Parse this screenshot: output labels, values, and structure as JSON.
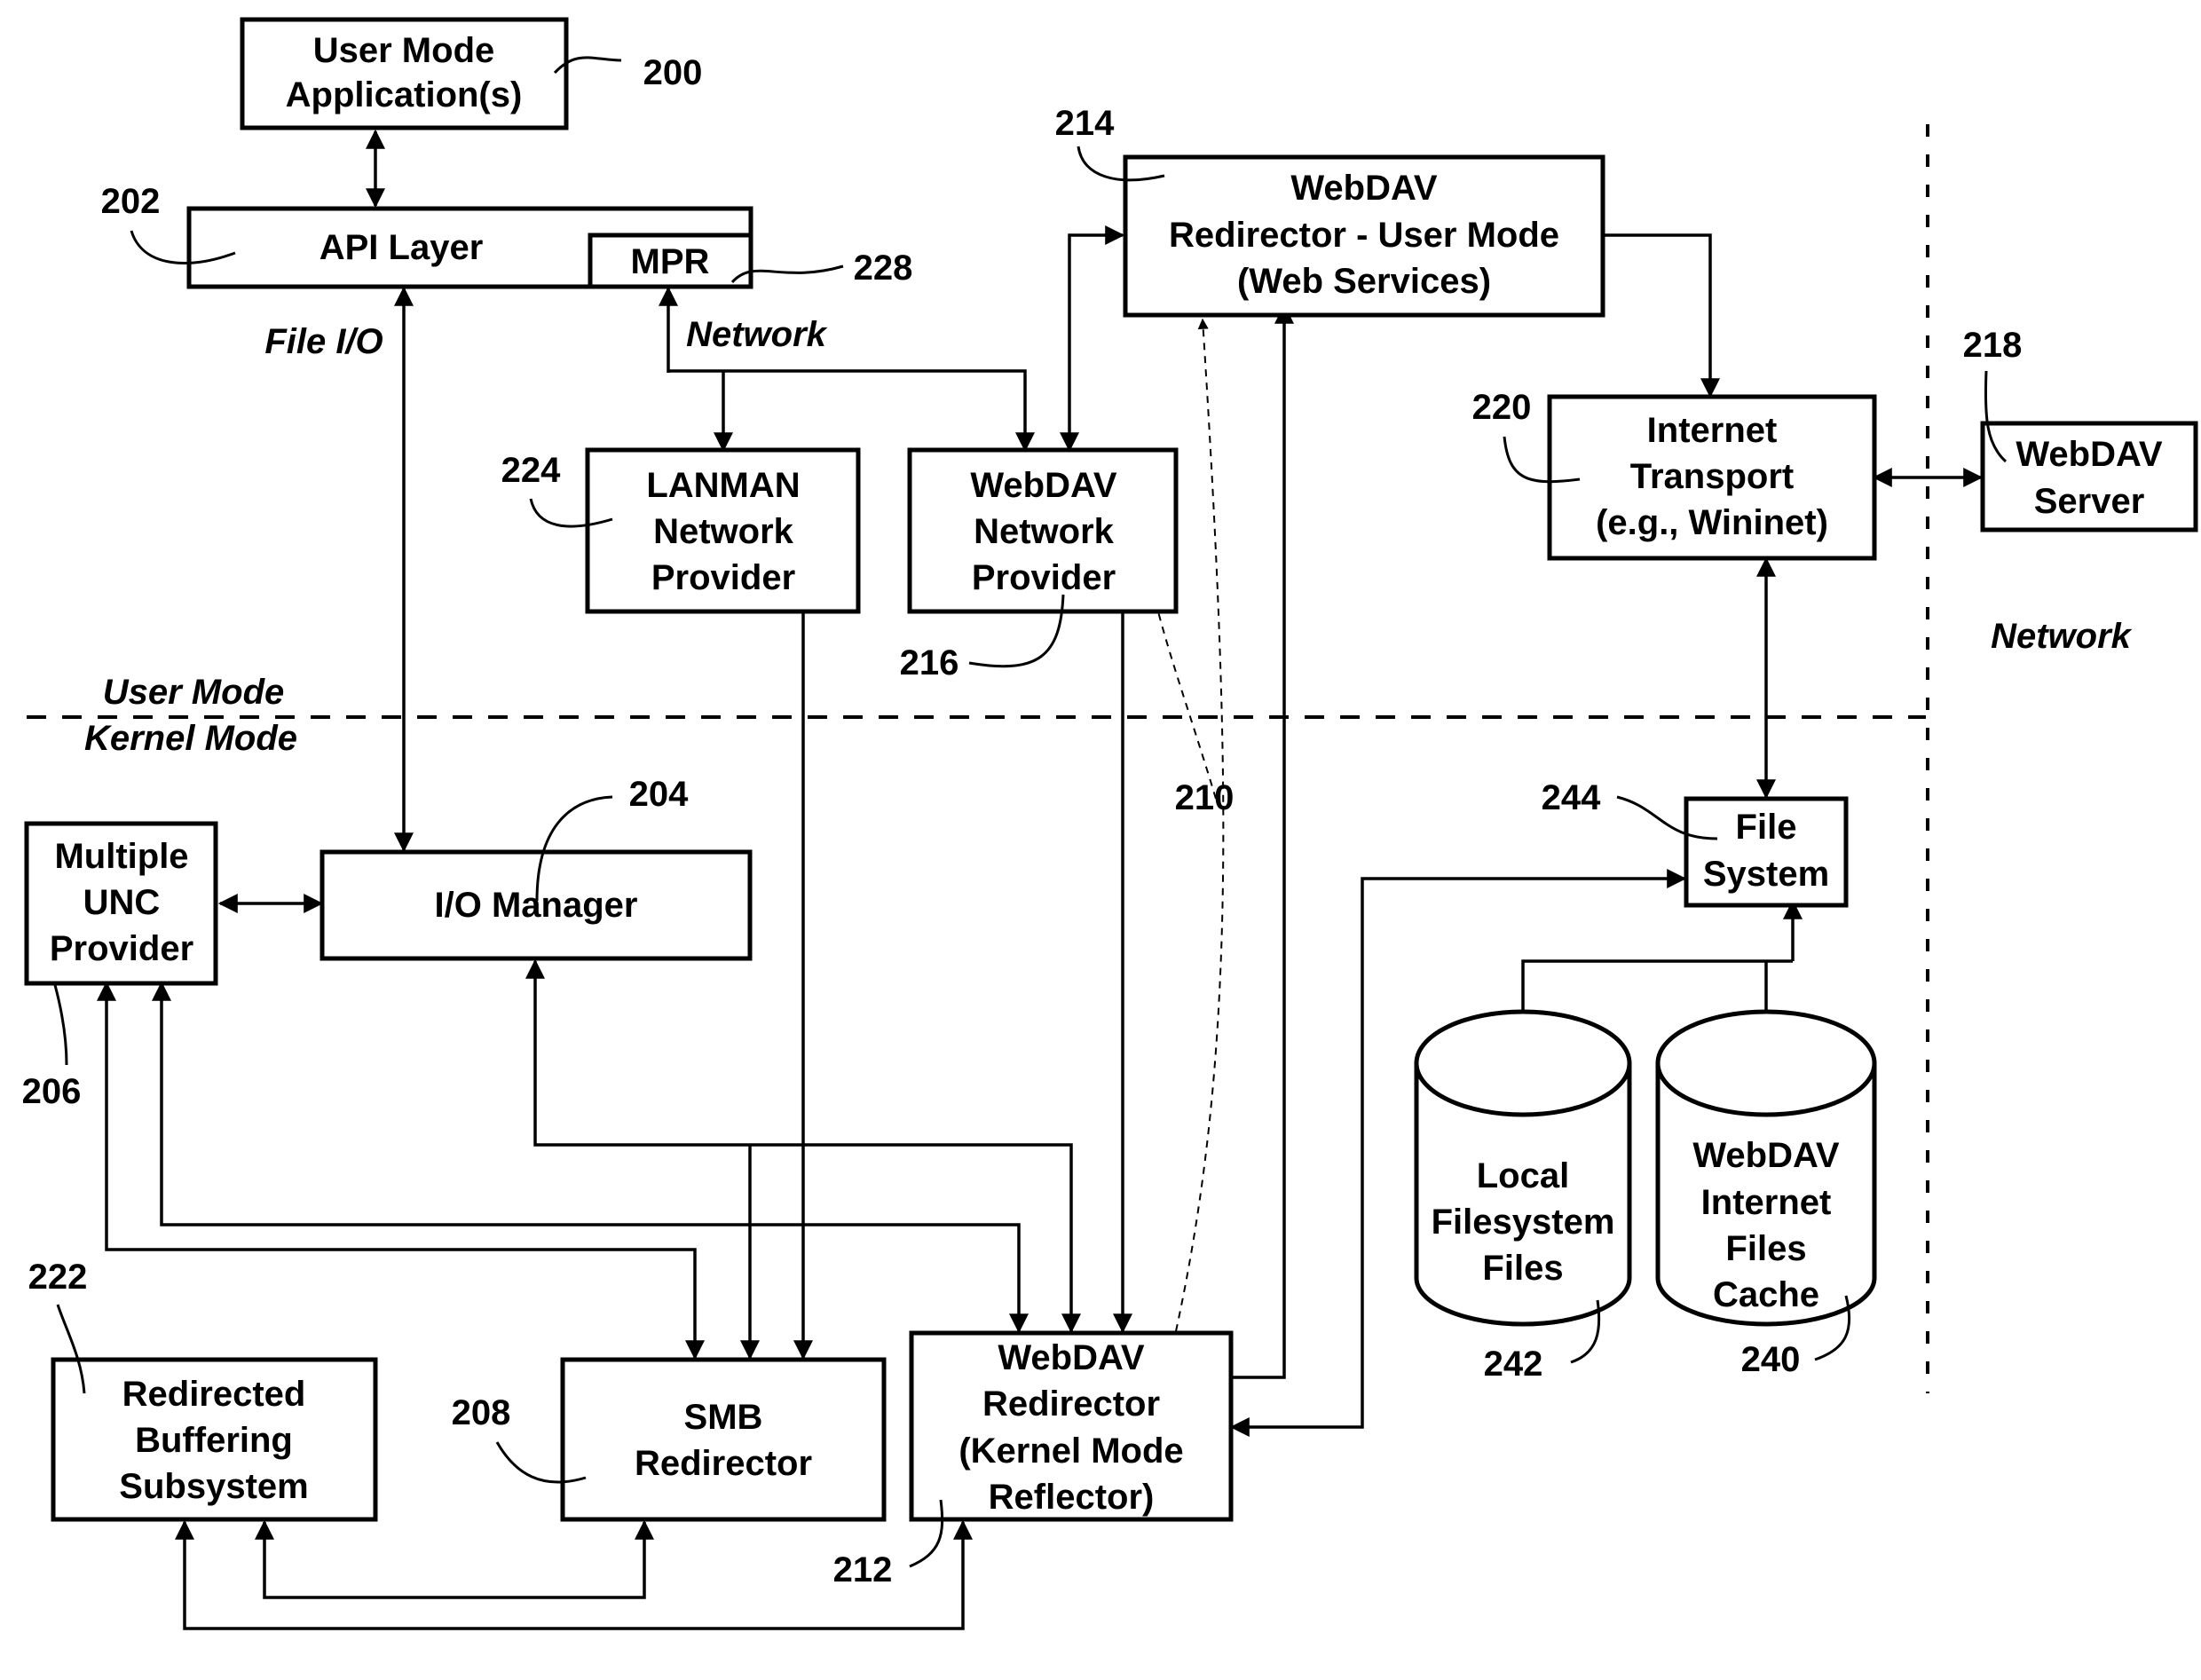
{
  "boxes": {
    "user_mode_apps": [
      "User Mode",
      "Application(s)"
    ],
    "api_layer": "API Layer",
    "mpr": "MPR",
    "webdav_user_redirector": [
      "WebDAV",
      "Redirector - User Mode",
      "(Web Services)"
    ],
    "lanman_provider": [
      "LANMAN",
      "Network",
      "Provider"
    ],
    "webdav_provider": [
      "WebDAV",
      "Network",
      "Provider"
    ],
    "internet_transport": [
      "Internet",
      "Transport",
      "(e.g., Wininet)"
    ],
    "webdav_server": [
      "WebDAV",
      "Server"
    ],
    "multiple_unc": [
      "Multiple",
      "UNC",
      "Provider"
    ],
    "io_manager": "I/O Manager",
    "file_system": [
      "File",
      "System"
    ],
    "local_files": [
      "Local",
      "Filesystem",
      "Files"
    ],
    "webdav_cache": [
      "WebDAV",
      "Internet",
      "Files",
      "Cache"
    ],
    "redirected_buffering": [
      "Redirected",
      "Buffering",
      "Subsystem"
    ],
    "smb_redirector": [
      "SMB",
      "Redirector"
    ],
    "webdav_kernel_redirector": [
      "WebDAV",
      "Redirector",
      "(Kernel Mode",
      "Reflector)"
    ]
  },
  "annotations": {
    "file_io": "File I/O",
    "network_path": "Network",
    "user_mode": "User Mode",
    "kernel_mode": "Kernel Mode",
    "network_zone": "Network"
  },
  "refs": {
    "r200": "200",
    "r202": "202",
    "r204": "204",
    "r206": "206",
    "r208": "208",
    "r210": "210",
    "r212": "212",
    "r214": "214",
    "r216": "216",
    "r218": "218",
    "r220": "220",
    "r222": "222",
    "r224": "224",
    "r228": "228",
    "r240": "240",
    "r242": "242",
    "r244": "244"
  }
}
